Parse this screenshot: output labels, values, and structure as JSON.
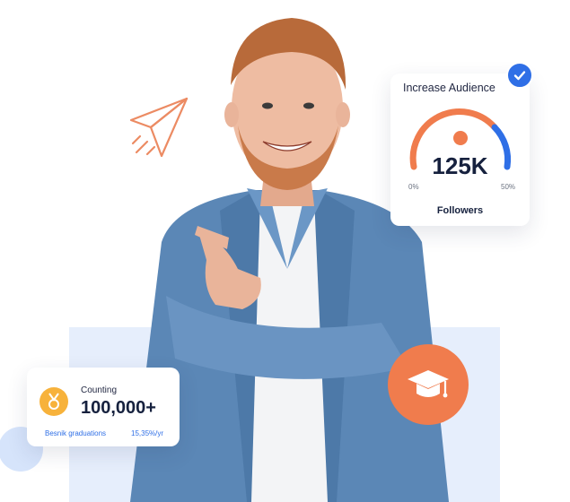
{
  "colors": {
    "accent_orange": "#f07c4d",
    "accent_blue": "#2f6fe6",
    "medal_yellow": "#f7b23b",
    "panel_blue": "#e6eefc"
  },
  "audience_card": {
    "title": "Increase Audience",
    "value": "125K",
    "min_label": "0%",
    "max_label": "50%",
    "footer": "Followers",
    "badge_icon": "check-icon"
  },
  "counting_card": {
    "label": "Counting",
    "value": "100,000+",
    "meta_left": "Besnik graduations",
    "meta_right": "15,35%/yr",
    "icon": "medal-icon"
  },
  "decorations": {
    "plane_icon": "paper-plane-icon",
    "graduation_icon": "graduation-cap-icon"
  }
}
